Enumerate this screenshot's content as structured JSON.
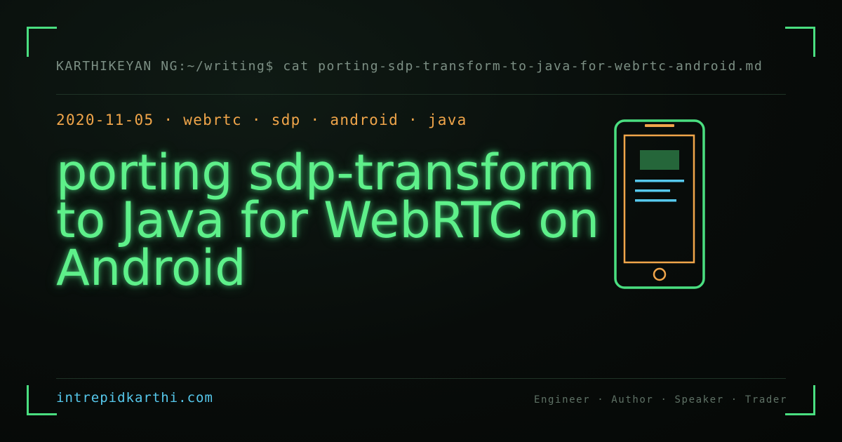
{
  "header": {
    "prompt": "KARTHIKEYAN NG:~/writing$ cat porting-sdp-transform-to-java-for-webrtc-android.md"
  },
  "post": {
    "meta": "2020-11-05 · webrtc · sdp · android · java",
    "title": "porting sdp-transform to Java for WebRTC on Android"
  },
  "footer": {
    "site": "intrepidkarthi.com",
    "roles": "Engineer · Author · Speaker · Trader"
  },
  "illustration": {
    "icon": "smartphone-icon"
  },
  "colors": {
    "accent_green": "#4ade80",
    "title_green": "#5ef08a",
    "meta_orange": "#f0a54a",
    "link_blue": "#56c8ec",
    "muted_gray": "#7c8f84",
    "background": "#080c0a"
  }
}
